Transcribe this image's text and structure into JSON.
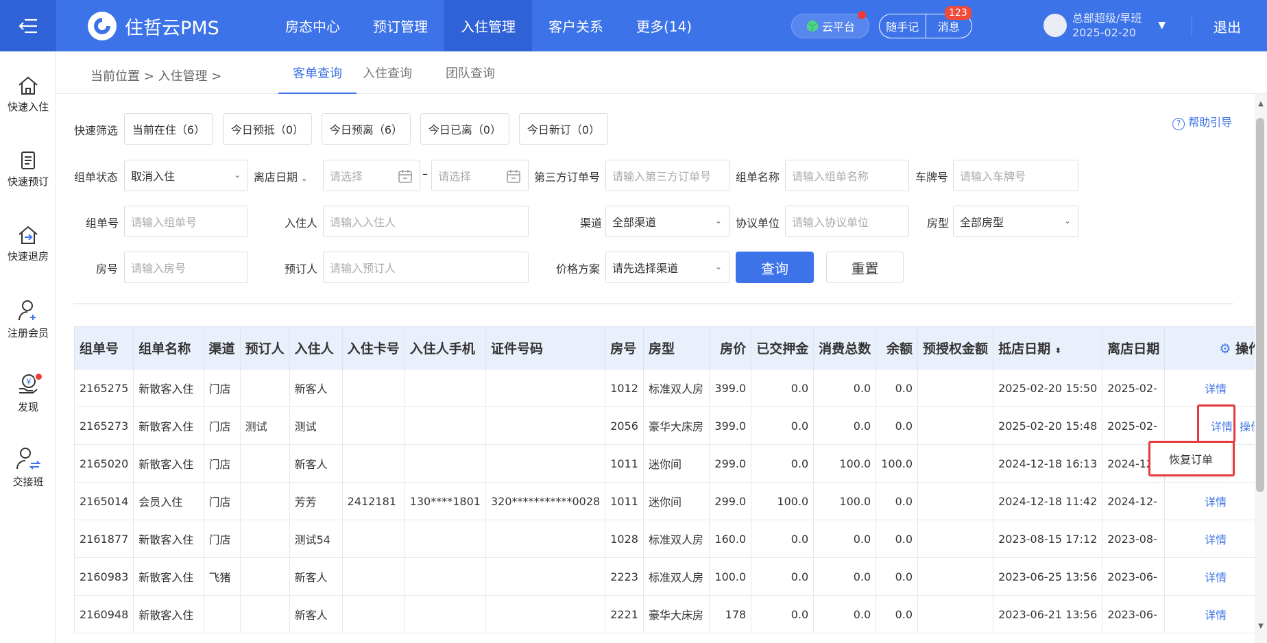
{
  "header": {
    "brand": "住哲云PMS",
    "nav": [
      "房态中心",
      "预订管理",
      "入住管理",
      "客户关系",
      "更多(14)"
    ],
    "active_nav": 2,
    "cloud_label": "云平台",
    "notes_label": "随手记",
    "messages_label": "消息",
    "messages_count": "123",
    "user_name": "总部超级/早班",
    "user_date": "2025-02-20",
    "logout": "退出"
  },
  "sidebar": [
    {
      "label": "快速入住",
      "icon": "home-icon"
    },
    {
      "label": "快速预订",
      "icon": "document-icon"
    },
    {
      "label": "快速退房",
      "icon": "checkout-icon"
    },
    {
      "label": "注册会员",
      "icon": "user-add-icon"
    },
    {
      "label": "发现",
      "icon": "discover-icon"
    },
    {
      "label": "交接班",
      "icon": "shift-icon"
    }
  ],
  "breadcrumb": "当前位置 > 入住管理 >",
  "tabs": [
    "客单查询",
    "入住查询",
    "团队查询"
  ],
  "help": "帮助引导",
  "filters": {
    "quick_label": "快速筛选",
    "quick": [
      "当前在住（6）",
      "今日预抵（0）",
      "今日预离（6）",
      "今日已离（0）",
      "今日新订（0）"
    ],
    "group_status_label": "组单状态",
    "group_status_value": "取消入住",
    "depart_label": "离店日期",
    "date_placeholder": "请选择",
    "third_party_label": "第三方订单号",
    "third_party_placeholder": "请输入第三方订单号",
    "group_name_label": "组单名称",
    "group_name_placeholder": "请输入组单名称",
    "plate_label": "车牌号",
    "plate_placeholder": "请输入车牌号",
    "group_no_label": "组单号",
    "group_no_placeholder": "请输入组单号",
    "guest_label": "入住人",
    "guest_placeholder": "请输入入住人",
    "channel_label": "渠道",
    "channel_value": "全部渠道",
    "agreement_label": "协议单位",
    "agreement_placeholder": "请输入协议单位",
    "room_type_label": "房型",
    "room_type_value": "全部房型",
    "room_no_label": "房号",
    "room_no_placeholder": "请输入房号",
    "booker_label": "预订人",
    "booker_placeholder": "请输入预订人",
    "price_plan_label": "价格方案",
    "price_plan_value": "请先选择渠道",
    "search": "查询",
    "reset": "重置"
  },
  "table": {
    "columns": [
      "组单号",
      "组单名称",
      "渠道",
      "预订人",
      "入住人",
      "入住卡号",
      "入住人手机",
      "证件号码",
      "房号",
      "房型",
      "房价",
      "已交押金",
      "消费总数",
      "余额",
      "预授权金额",
      "抵店日期",
      "离店日期",
      "操作"
    ],
    "rows": [
      [
        "2165275",
        "新散客入住",
        "门店",
        "",
        "新客人",
        "",
        "",
        "",
        "1012",
        "标准双人房",
        "399.0",
        "0.0",
        "0.0",
        "0.0",
        "",
        "2025-02-20 15:50",
        "2025-02-"
      ],
      [
        "2165273",
        "新散客入住",
        "门店",
        "测试",
        "测试",
        "",
        "",
        "",
        "2056",
        "豪华大床房",
        "399.0",
        "0.0",
        "0.0",
        "0.0",
        "",
        "2025-02-20 15:48",
        "2025-02-"
      ],
      [
        "2165020",
        "新散客入住",
        "门店",
        "",
        "新客人",
        "",
        "",
        "",
        "1011",
        "迷你间",
        "299.0",
        "0.0",
        "100.0",
        "100.0",
        "",
        "2024-12-18 16:13",
        "2024-12-"
      ],
      [
        "2165014",
        "会员入住",
        "门店",
        "",
        "芳芳",
        "2412181",
        "130****1801",
        "320***********0028",
        "1011",
        "迷你间",
        "299.0",
        "100.0",
        "100.0",
        "0.0",
        "",
        "2024-12-18 11:42",
        "2024-12-"
      ],
      [
        "2161877",
        "新散客入住",
        "门店",
        "",
        "测试54",
        "",
        "",
        "",
        "1028",
        "标准双人房",
        "160.0",
        "0.0",
        "0.0",
        "0.0",
        "",
        "2023-08-15 17:12",
        "2023-08-"
      ],
      [
        "2160983",
        "新散客入住",
        "飞猪",
        "",
        "新客人",
        "",
        "",
        "",
        "2223",
        "标准双人房",
        "100.0",
        "0.0",
        "0.0",
        "0.0",
        "",
        "2023-06-25 13:56",
        "2023-06-"
      ],
      [
        "2160948",
        "新散客入住",
        "",
        "",
        "新客人",
        "",
        "",
        "",
        "2221",
        "豪华大床房",
        "178",
        "0.0",
        "0.0",
        "0.0",
        "",
        "2023-06-21 13:56",
        "2023-06-"
      ]
    ],
    "detail_label": "详情",
    "operate_label": "操作",
    "restore_label": "恢复订单"
  },
  "colors": {
    "primary": "#3d73e8",
    "highlight": "#e53b3b"
  }
}
